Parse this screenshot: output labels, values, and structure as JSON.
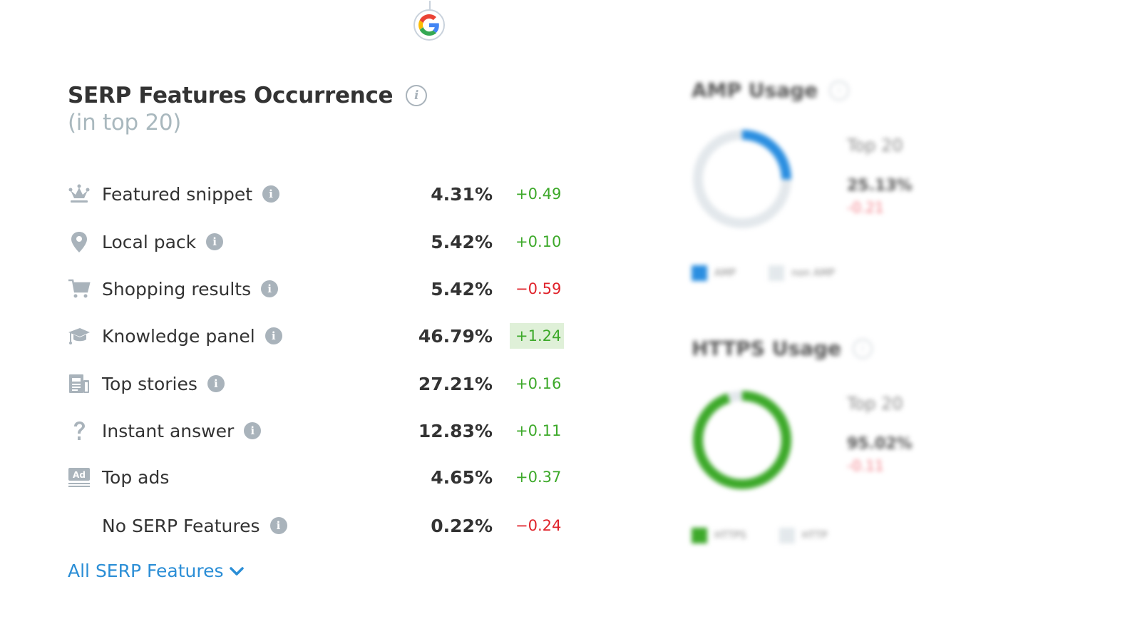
{
  "google_badge": {
    "icon": "google-g-icon",
    "colors": [
      "#4285F4",
      "#EA4335",
      "#FBBC05",
      "#34A853"
    ]
  },
  "serp_features": {
    "title": "SERP Features Occurrence",
    "subtitle": "(in top 20)",
    "info_icon": "i",
    "rows": [
      {
        "icon": "crown-icon",
        "label": "Featured snippet",
        "has_info": true,
        "value": "4.31%",
        "delta": "+0.49",
        "trend": "pos",
        "highlight": false
      },
      {
        "icon": "map-pin-icon",
        "label": "Local pack",
        "has_info": true,
        "value": "5.42%",
        "delta": "+0.10",
        "trend": "pos",
        "highlight": false
      },
      {
        "icon": "shopping-cart-icon",
        "label": "Shopping results",
        "has_info": true,
        "value": "5.42%",
        "delta": "−0.59",
        "trend": "neg",
        "highlight": false
      },
      {
        "icon": "graduation-cap-icon",
        "label": "Knowledge panel",
        "has_info": true,
        "value": "46.79%",
        "delta": "+1.24",
        "trend": "pos",
        "highlight": true
      },
      {
        "icon": "newspaper-icon",
        "label": "Top stories",
        "has_info": true,
        "value": "27.21%",
        "delta": "+0.16",
        "trend": "pos",
        "highlight": false
      },
      {
        "icon": "question-mark-icon",
        "label": "Instant answer",
        "has_info": true,
        "value": "12.83%",
        "delta": "+0.11",
        "trend": "pos",
        "highlight": false
      },
      {
        "icon": "ad-icon",
        "label": "Top ads",
        "has_info": false,
        "value": "4.65%",
        "delta": "+0.37",
        "trend": "pos",
        "highlight": false
      },
      {
        "icon": "",
        "label": "No SERP Features",
        "has_info": true,
        "value": "0.22%",
        "delta": "−0.24",
        "trend": "neg",
        "highlight": false
      }
    ],
    "all_link": "All SERP Features"
  },
  "amp_usage": {
    "title": "AMP Usage",
    "period": "Top 20",
    "percent": "25.13%",
    "fraction": 0.2513,
    "delta": "-0.21",
    "color": "#2a8ee0",
    "track_color": "#e3e8ec",
    "legend": [
      {
        "label": "AMP",
        "color": "#2a8ee0"
      },
      {
        "label": "non AMP",
        "color": "#e3e8ec"
      }
    ]
  },
  "https_usage": {
    "title": "HTTPS Usage",
    "period": "Top 20",
    "percent": "95.02%",
    "fraction": 0.9502,
    "delta": "-0.11",
    "color": "#3da92a",
    "track_color": "#e3e8ec",
    "legend": [
      {
        "label": "HTTPS",
        "color": "#3da92a"
      },
      {
        "label": "HTTP",
        "color": "#e3e8ec"
      }
    ]
  },
  "colors": {
    "positive": "#3da92a",
    "negative": "#e0232b",
    "highlight_bg": "#dff0d8",
    "link": "#2b8ed6",
    "icon_gray": "#a9b3bb"
  }
}
